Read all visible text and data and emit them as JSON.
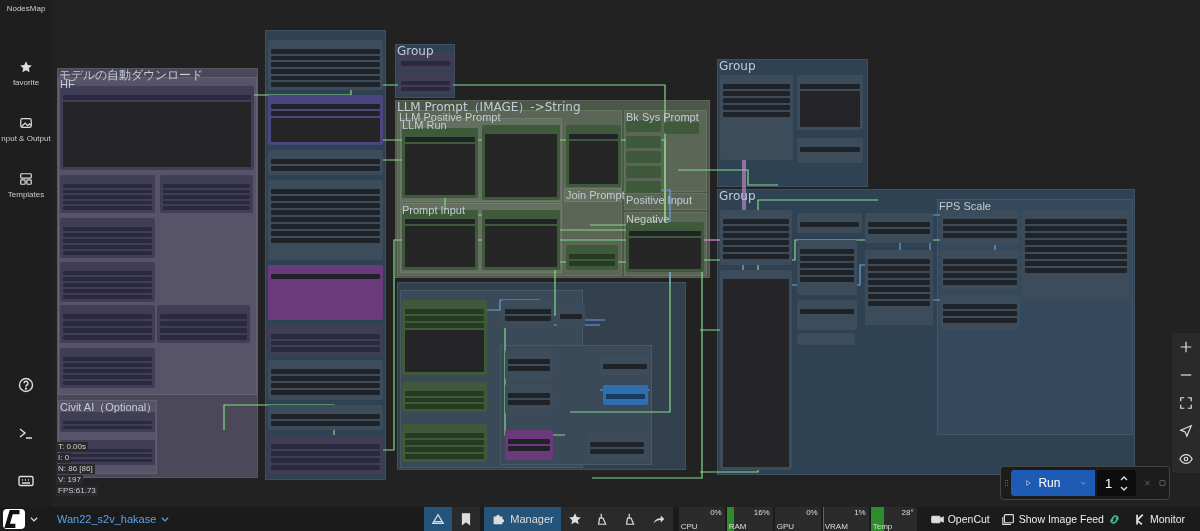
{
  "sidebar": {
    "items": [
      {
        "label": "NodesMap"
      },
      {
        "label": "favorite"
      },
      {
        "label": "nput & Output"
      },
      {
        "label": "Templates"
      }
    ]
  },
  "canvas": {
    "groups": [
      {
        "title": "モデルの自動ダウンロード",
        "color": "#4b4859",
        "children": [
          {
            "title": "HF",
            "color": "#57546a"
          },
          {
            "title": "Civit AI（Optional）",
            "color": "#57546a"
          }
        ]
      },
      {
        "color": "#2f4254"
      },
      {
        "title": "Group",
        "color": "#2f4254"
      },
      {
        "title": "LLM Prompt（IMAGE）->String",
        "color": "#4d5748",
        "children": [
          {
            "title": "LLM Positive Prompt",
            "color": "#5b6656",
            "children": [
              {
                "title": "LLM Run",
                "color": "#647060"
              },
              {
                "title": "Prompt Input",
                "color": "#647060"
              },
              {
                "title": "Join Prompt",
                "color": "#647060"
              }
            ]
          },
          {
            "title": "Bk Sys Prompt",
            "color": "#5b6656"
          },
          {
            "title": "Positive Input",
            "color": "#5b6656"
          },
          {
            "title": "Negative",
            "color": "#5b6656"
          }
        ]
      },
      {
        "color": "#33414e",
        "children": [
          {
            "color": "#3a4a58"
          },
          {
            "color": "#3a4a58"
          }
        ]
      },
      {
        "title": "Group",
        "color": "#2f4254"
      },
      {
        "title": "Group",
        "color": "#2f4254",
        "children": [
          {
            "title": "FPS Scale",
            "color": "#34495c"
          }
        ]
      }
    ]
  },
  "stats": [
    "T: 0.00s",
    "I: 0",
    "N: 86 [86]",
    "V: 197",
    "FPS:61.73"
  ],
  "workflow": {
    "name": "Wan22_s2v_hakase"
  },
  "toolbar": {
    "manager": "Manager"
  },
  "monitors": [
    {
      "label": "CPU",
      "reading": "0%",
      "level": 0
    },
    {
      "label": "RAM",
      "reading": "16%",
      "level": 0.16
    },
    {
      "label": "GPU",
      "reading": "0%",
      "level": 0
    },
    {
      "label": "VRAM",
      "reading": "1%",
      "level": 0.01
    },
    {
      "label": "Temp",
      "reading": "28°",
      "level": 0.28
    }
  ],
  "actions": [
    "OpenCut",
    "Show Image Feed",
    "Monitor"
  ],
  "run": {
    "label": "Run",
    "count": "1"
  }
}
